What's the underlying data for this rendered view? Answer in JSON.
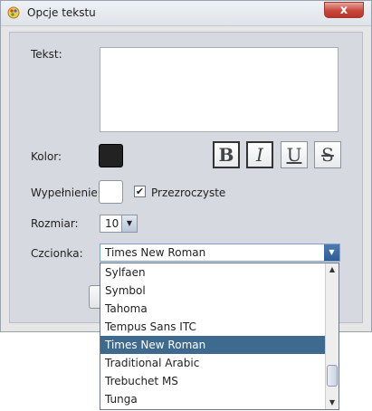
{
  "window": {
    "title": "Opcje tekstu",
    "close_glyph": "x",
    "app_icon": "paint-palette-icon"
  },
  "labels": {
    "text": "Tekst:",
    "color": "Kolor:",
    "fill": "Wypełnienie:",
    "size": "Rozmiar:",
    "font": "Czcionka:"
  },
  "colors": {
    "text_color": "#222222",
    "fill_color": "#ffffff",
    "selection": "#3e6a8f"
  },
  "format_buttons": {
    "bold": "B",
    "italic": "I",
    "underline": "U",
    "strike": "S"
  },
  "transparent": {
    "label": "Przezroczyste",
    "checked": true,
    "check_glyph": "✔"
  },
  "size": {
    "value": "10",
    "arrow": "▼"
  },
  "font": {
    "selected": "Times New Roman",
    "arrow": "▼",
    "options": [
      "Sylfaen",
      "Symbol",
      "Tahoma",
      "Tempus Sans ITC",
      "Times New Roman",
      "Traditional Arabic",
      "Trebuchet MS",
      "Tunga"
    ],
    "selected_index": 4
  },
  "scrollbar": {
    "up": "▲",
    "down": "▼"
  }
}
